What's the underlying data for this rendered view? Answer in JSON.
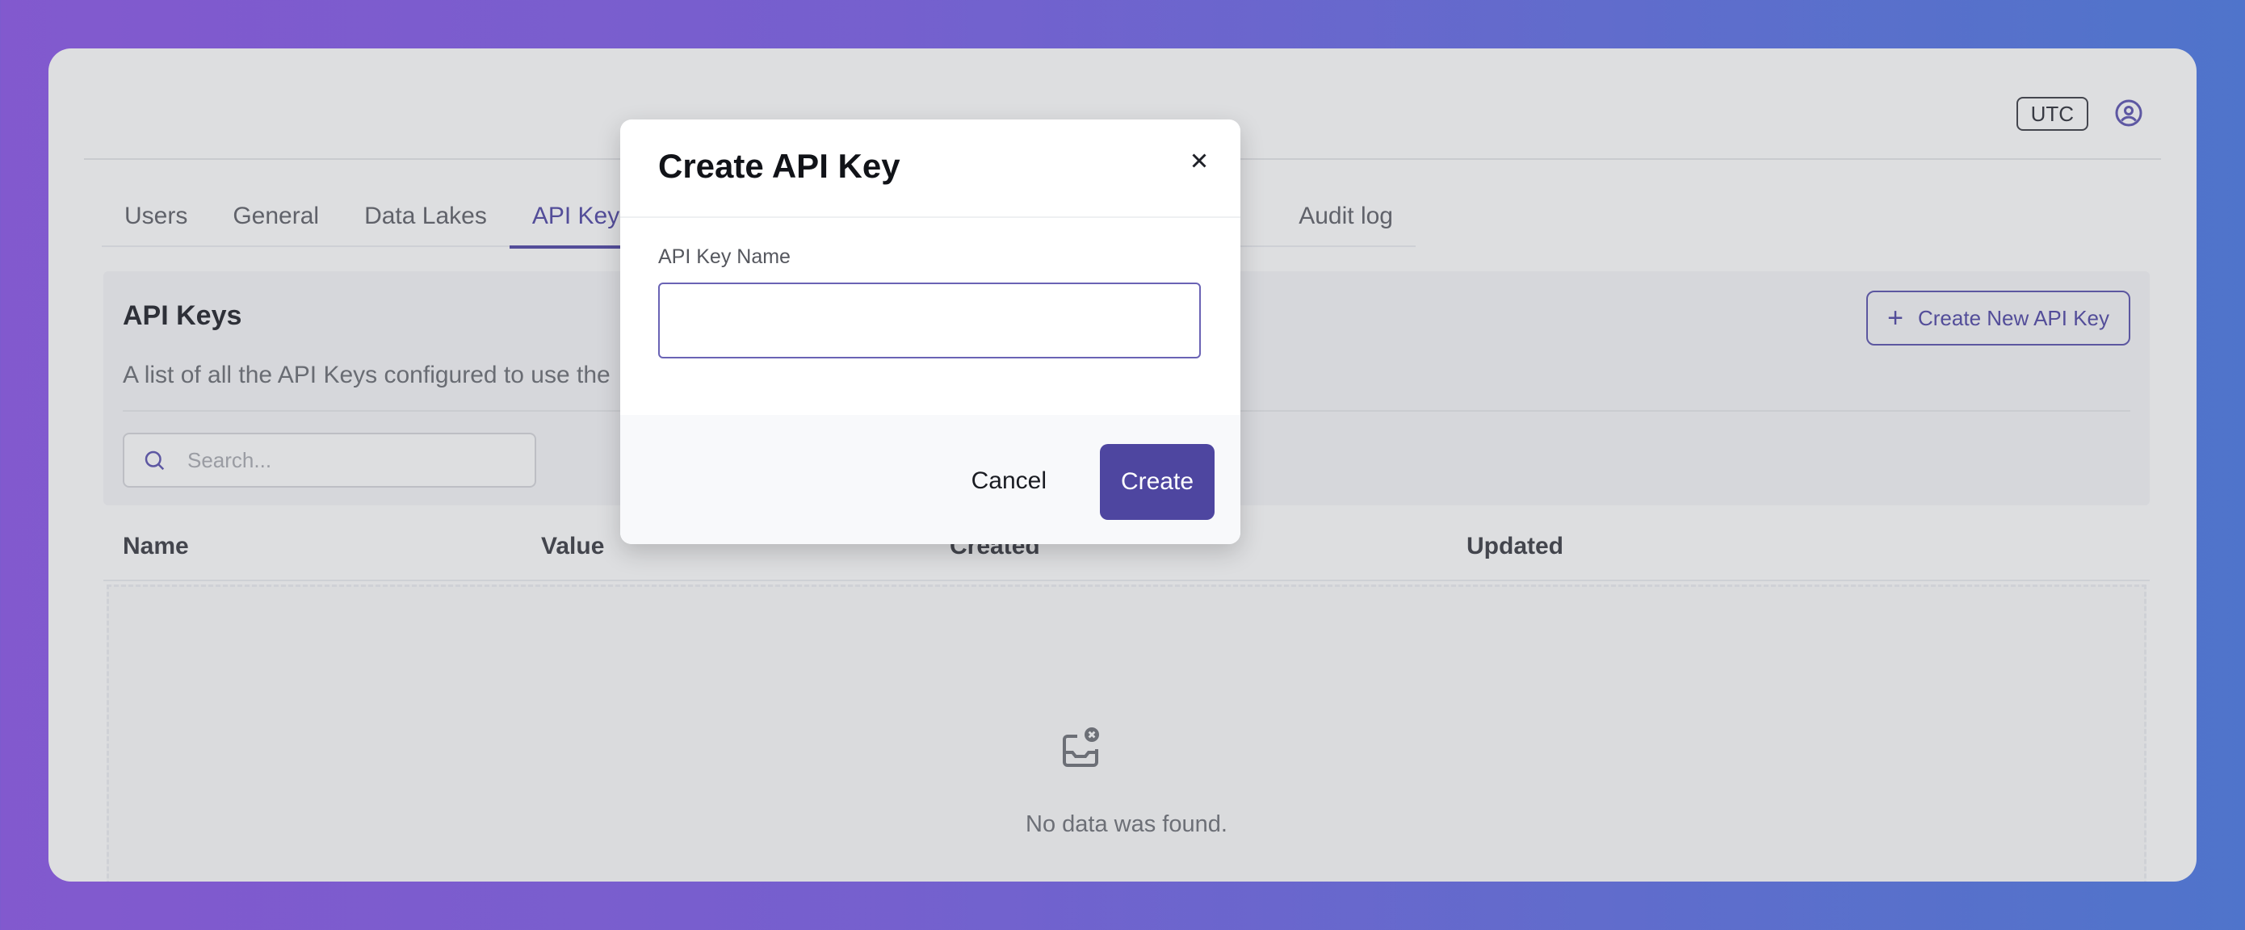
{
  "colors": {
    "accent": "#4f46a5",
    "primary_button": "#4e46a0",
    "background_gradient_start": "#8b55e8",
    "background_gradient_end": "#4a78e4"
  },
  "header": {
    "timezone_label": "UTC",
    "user_icon": "user-circle-icon"
  },
  "tabs": [
    {
      "label": "Users",
      "active": false
    },
    {
      "label": "General",
      "active": false
    },
    {
      "label": "Data Lakes",
      "active": false
    },
    {
      "label": "API Keys",
      "active": true
    },
    {
      "label": "Audit log",
      "active": false
    }
  ],
  "panel": {
    "title": "API Keys",
    "description": "A list of all the API Keys configured to use the",
    "create_button_label": "Create New API Key",
    "create_button_icon": "plus-icon",
    "search_placeholder": "Search..."
  },
  "table": {
    "columns": [
      "Name",
      "Value",
      "Created",
      "Updated"
    ],
    "rows": [],
    "empty_icon": "inbox-x-icon",
    "empty_text": "No data was found."
  },
  "modal": {
    "title": "Create API Key",
    "field_label": "API Key Name",
    "field_value": "",
    "cancel_label": "Cancel",
    "create_label": "Create"
  }
}
